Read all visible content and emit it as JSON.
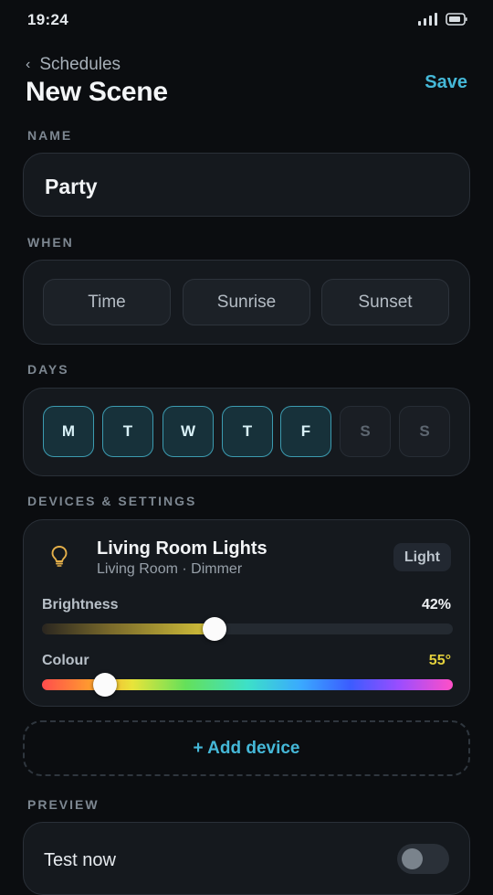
{
  "status": {
    "time": "19:24"
  },
  "header": {
    "back_label": "Schedules",
    "title": "New Scene",
    "save_label": "Save"
  },
  "name_section": {
    "label": "NAME",
    "value": "Party"
  },
  "when_section": {
    "label": "WHEN",
    "options": [
      "Time",
      "Sunrise",
      "Sunset"
    ]
  },
  "days_section": {
    "label": "DAYS",
    "days": [
      {
        "letter": "M",
        "selected": true
      },
      {
        "letter": "T",
        "selected": true
      },
      {
        "letter": "W",
        "selected": true
      },
      {
        "letter": "T",
        "selected": true
      },
      {
        "letter": "F",
        "selected": true
      },
      {
        "letter": "S",
        "selected": false
      },
      {
        "letter": "S",
        "selected": false
      }
    ]
  },
  "devices_section": {
    "label": "DEVICES & SETTINGS",
    "device": {
      "icon": "lightbulb-icon",
      "name": "Living Room Lights",
      "subtitle": "Living Room · Dimmer",
      "badge": "Light",
      "brightness": {
        "label": "Brightness",
        "value_text": "42%",
        "value": 0.42
      },
      "colour": {
        "label": "Colour",
        "value_text": "55°",
        "value": 55,
        "max": 360,
        "value_color": "#e3d03c"
      }
    }
  },
  "add_device_label": "+ Add device",
  "preview_section": {
    "label": "PREVIEW",
    "test_label": "Test now",
    "test_enabled": false
  },
  "colors": {
    "accent": "#45b8d8",
    "day_selected_border": "#3c9bb0",
    "background": "#0b0d10"
  }
}
